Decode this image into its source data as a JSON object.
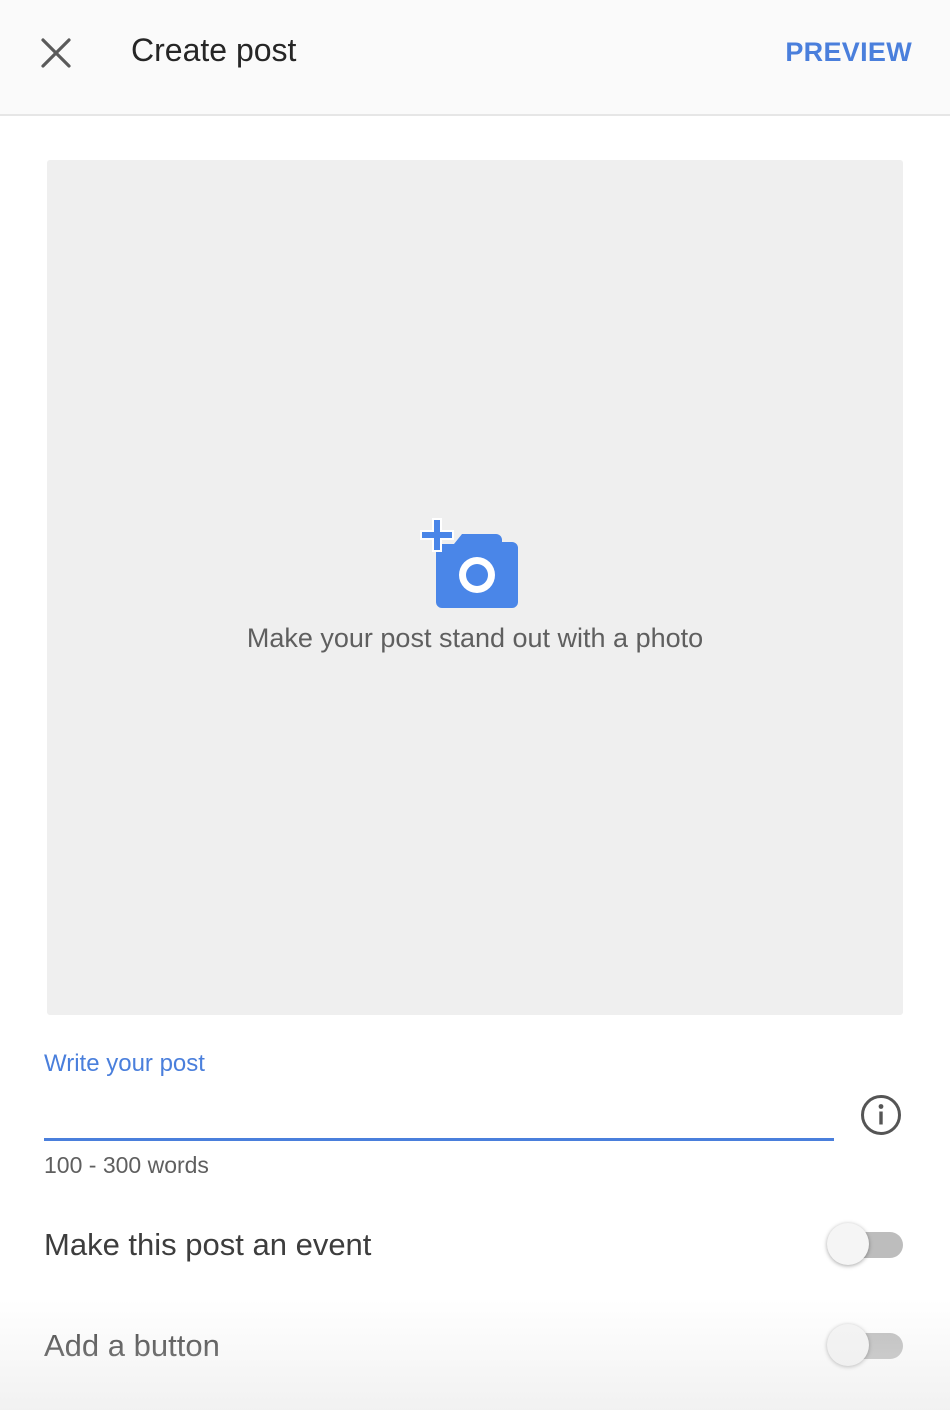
{
  "header": {
    "close_icon": "close-icon",
    "title": "Create post",
    "preview_label": "PREVIEW"
  },
  "photo": {
    "icon": "add-photo-camera-icon",
    "hint": "Make your post stand out with a photo"
  },
  "post_field": {
    "label": "Write your post",
    "value": "",
    "placeholder": "",
    "helper": "100 - 300 words",
    "info_icon": "info-icon"
  },
  "options": [
    {
      "label": "Make this post an event",
      "enabled": false
    },
    {
      "label": "Add a button",
      "enabled": false
    }
  ],
  "colors": {
    "accent": "#4a7fdc",
    "photo_background": "#efefef",
    "toggle_track_off": "#bdbdbd"
  }
}
